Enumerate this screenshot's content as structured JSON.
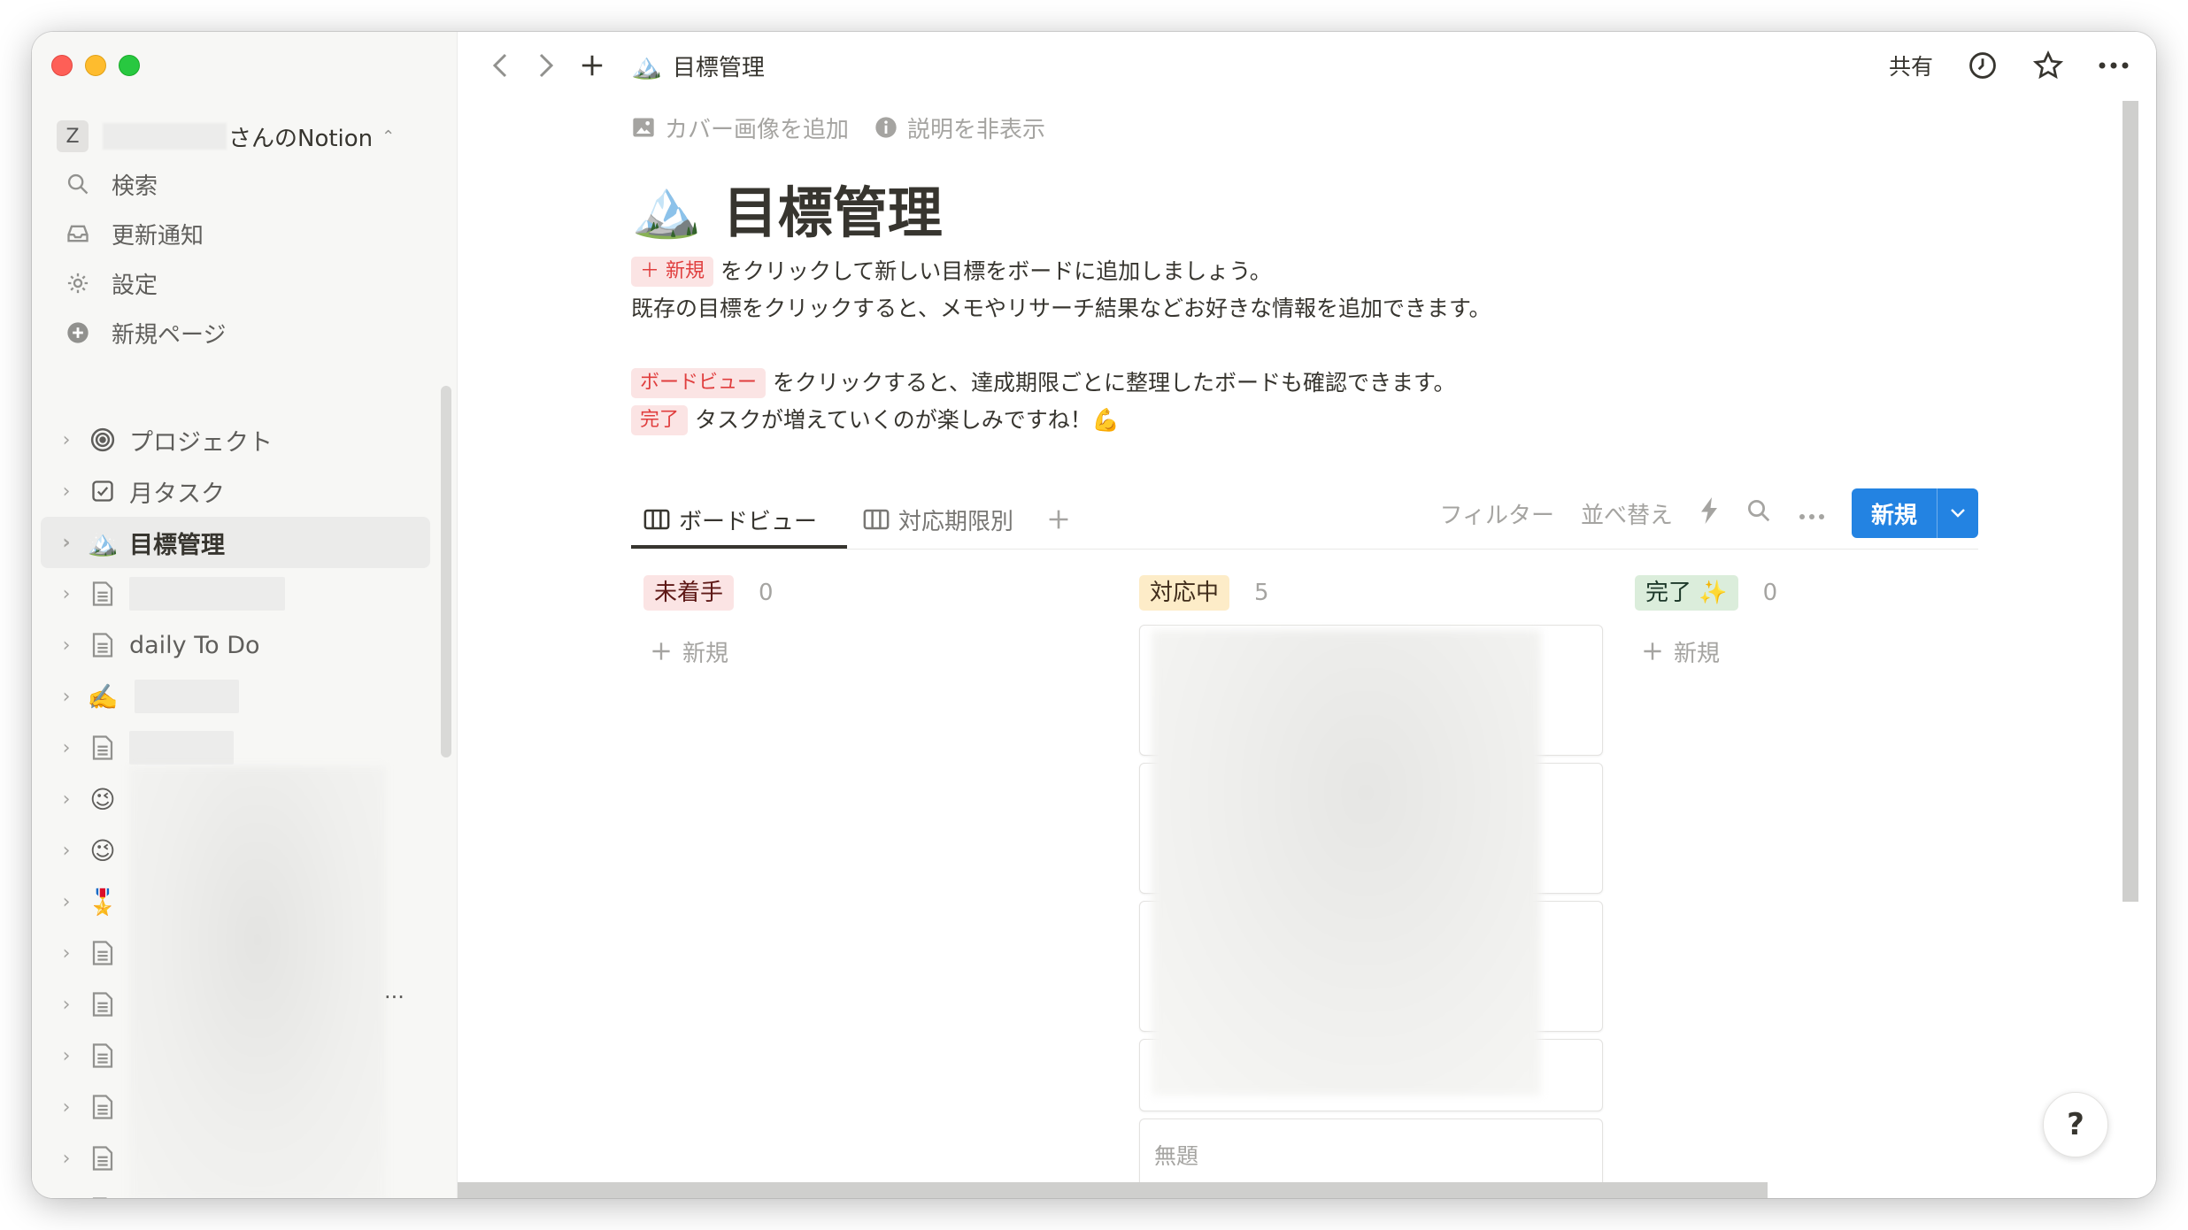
{
  "sidebar": {
    "workspace_initial": "Z",
    "workspace_name": "さんのNotion",
    "menu": [
      {
        "label": "検索",
        "icon": "search-icon"
      },
      {
        "label": "更新通知",
        "icon": "inbox-icon"
      },
      {
        "label": "設定",
        "icon": "gear-icon"
      },
      {
        "label": "新規ページ",
        "icon": "plus-circle-icon"
      }
    ],
    "pages": [
      {
        "label": "プロジェクト",
        "icon": "target-icon"
      },
      {
        "label": "月タスク",
        "icon": "checkbox-icon"
      },
      {
        "label": "目標管理",
        "icon": "mountain-icon",
        "emoji": "🏔️"
      },
      {
        "label": "",
        "icon": "page-icon"
      },
      {
        "label": "daily To Do",
        "icon": "page-icon"
      },
      {
        "label": "",
        "icon": "writing-hand-icon",
        "emoji": "✍️"
      },
      {
        "label": "",
        "icon": "page-icon"
      },
      {
        "label": "",
        "icon": "winking-face-icon",
        "emoji": "😉"
      },
      {
        "label": "",
        "icon": "winking-face-icon",
        "emoji": "😉"
      },
      {
        "label": "",
        "icon": "medal-icon",
        "emoji": "🎖️"
      },
      {
        "label": "",
        "icon": "page-icon"
      },
      {
        "label": "",
        "icon": "page-icon"
      },
      {
        "label": "",
        "icon": "page-icon"
      },
      {
        "label": "",
        "icon": "page-icon"
      },
      {
        "label": "",
        "icon": "page-icon"
      },
      {
        "label": "",
        "icon": "page-icon"
      }
    ],
    "more": "..."
  },
  "topbar": {
    "title": "目標管理",
    "title_emoji": "🏔️",
    "share": "共有"
  },
  "page": {
    "add_cover": "カバー画像を追加",
    "hide_description": "説明を非表示",
    "title": "目標管理",
    "title_emoji": "🏔️",
    "desc": {
      "tag_new": "＋ 新規",
      "line1": "をクリックして新しい目標をボードに追加しましょう。",
      "line2": "既存の目標をクリックすると、メモやリサーチ結果などお好きな情報を追加できます。",
      "tag_board": "ボードビュー",
      "line3": "をクリックすると、達成期限ごとに整理したボードも確認できます。",
      "tag_done": "完了",
      "line4": "タスクが増えていくのが楽しみですね！💪"
    }
  },
  "views": {
    "tabs": [
      "ボードビュー",
      "対応期限別"
    ],
    "filter": "フィルター",
    "sort": "並べ替え",
    "new_button": "新規"
  },
  "board": {
    "columns": [
      {
        "status": "未着手",
        "count": "0",
        "add_label": "新規",
        "bg": "#fbe4e4",
        "fg": "#5d1715"
      },
      {
        "status": "対応中",
        "count": "5",
        "add_label": "",
        "bg": "#fdecc8",
        "fg": "#402c1b"
      },
      {
        "status": "完了 ✨",
        "count": "0",
        "add_label": "新規",
        "bg": "#dbeddb",
        "fg": "#1c3829"
      }
    ],
    "untitled_card": "無題"
  },
  "help": "?"
}
